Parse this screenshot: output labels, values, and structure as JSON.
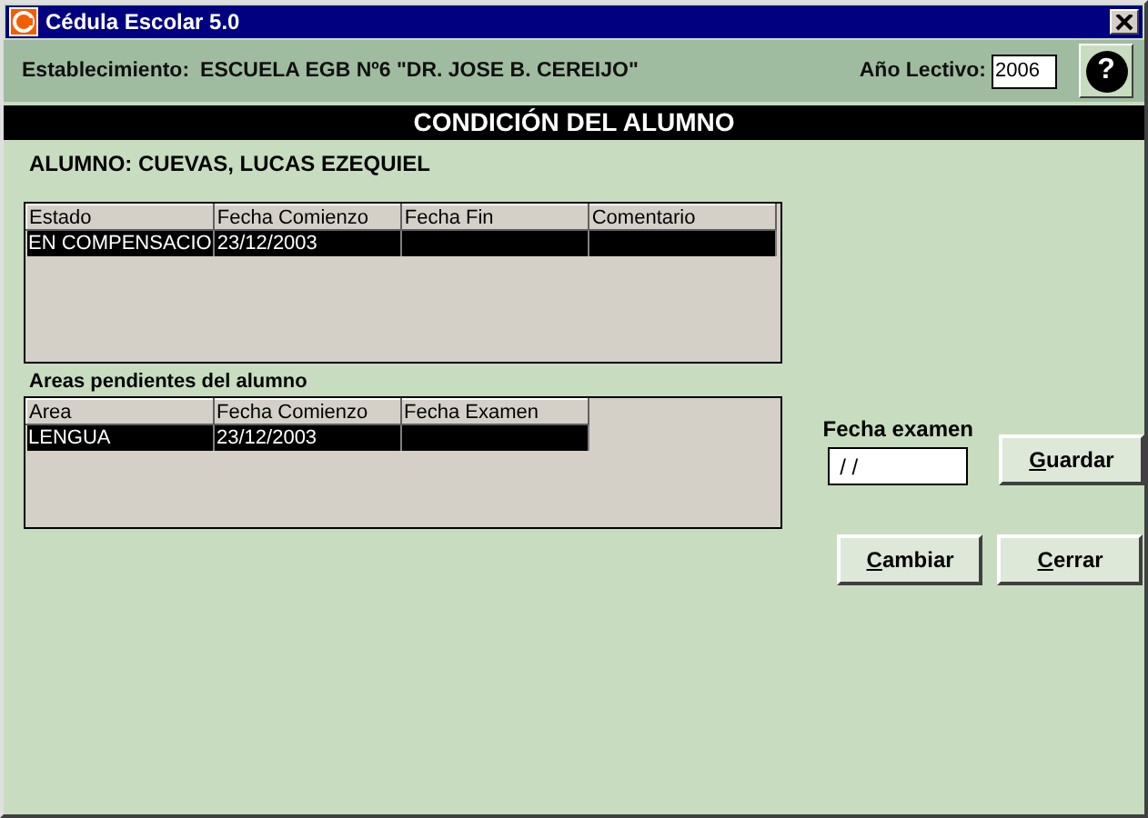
{
  "window": {
    "title": "Cédula Escolar 5.0"
  },
  "header": {
    "school_label": "Establecimiento:",
    "school": "ESCUELA EGB Nº6 \"DR. JOSE B. CEREIJO\"",
    "year_label": "Año Lectivo:",
    "year": "2006",
    "help": "?"
  },
  "banner": "CONDICIÓN DEL ALUMNO",
  "student": "ALUMNO: CUEVAS, LUCAS EZEQUIEL",
  "status_table": {
    "columns": [
      "Estado",
      "Fecha Comienzo",
      "Fecha Fin",
      "Comentario"
    ],
    "rows": [
      {
        "cells": [
          "EN COMPENSACIO",
          "23/12/2003",
          "",
          ""
        ],
        "selected": true
      }
    ]
  },
  "areas_title": "Areas pendientes del alumno",
  "areas_table": {
    "columns": [
      "Area",
      "Fecha Comienzo",
      "Fecha Examen"
    ],
    "rows": [
      {
        "cells": [
          "LENGUA",
          "23/12/2003",
          ""
        ],
        "selected": true
      }
    ]
  },
  "exam_date": {
    "label": "Fecha examen",
    "value": " / /"
  },
  "buttons": [
    {
      "label": "Guardar",
      "first_letter_underlined": true
    },
    {
      "label": "Cambiar",
      "first_letter_underlined": true
    },
    {
      "label": "Cerrar",
      "first_letter_underlined": true
    }
  ]
}
